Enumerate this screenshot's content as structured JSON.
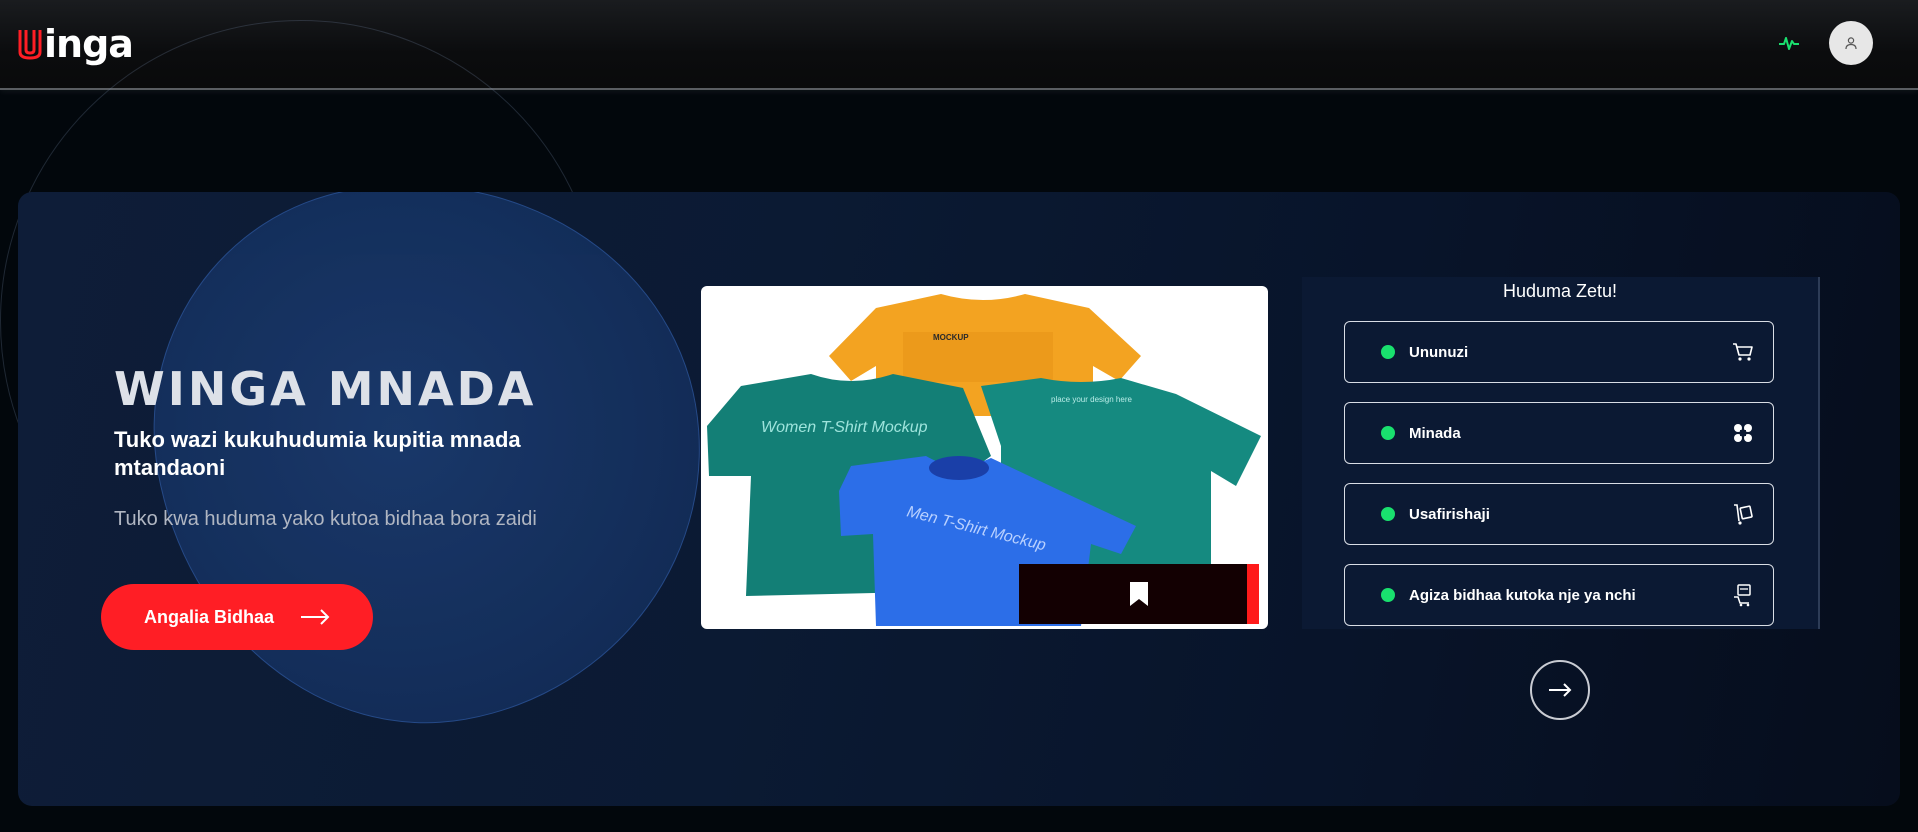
{
  "header": {
    "logo_text": "inga",
    "pulse_icon": "activity-pulse-icon",
    "pulse_color": "#19e06e",
    "avatar_icon": "user-icon"
  },
  "hero": {
    "title": "WINGA MNADA",
    "subtitle": "Tuko wazi kukuhudumia kupitia mnada mtandaoni",
    "description": "Tuko kwa huduma yako kutoa bidhaa bora zaidi",
    "cta_label": "Angalia Bidhaa",
    "cta_icon": "arrow-right-icon",
    "accent_color": "#ff1e25"
  },
  "product": {
    "shirts": [
      {
        "color": "#f3a321",
        "text": "MOCKUP"
      },
      {
        "color": "#137f76",
        "text": "Women T-Shirt Mockup"
      },
      {
        "color": "#137f76",
        "text": "place your design here"
      },
      {
        "color": "#2c6ee8",
        "text": "Men T-Shirt Mockup"
      }
    ],
    "bookmark_icon": "bookmark-icon"
  },
  "services": {
    "title": "Huduma Zetu!",
    "items": [
      {
        "label": "Ununuzi",
        "icon": "cart-icon"
      },
      {
        "label": "Minada",
        "icon": "grid-icon"
      },
      {
        "label": "Usafirishaji",
        "icon": "delivery-trolley-icon"
      },
      {
        "label": "Agiza bidhaa kutoka nje ya nchi",
        "icon": "import-order-icon"
      }
    ],
    "status_color": "#19e06e"
  },
  "navigation": {
    "next_icon": "arrow-right-icon"
  }
}
